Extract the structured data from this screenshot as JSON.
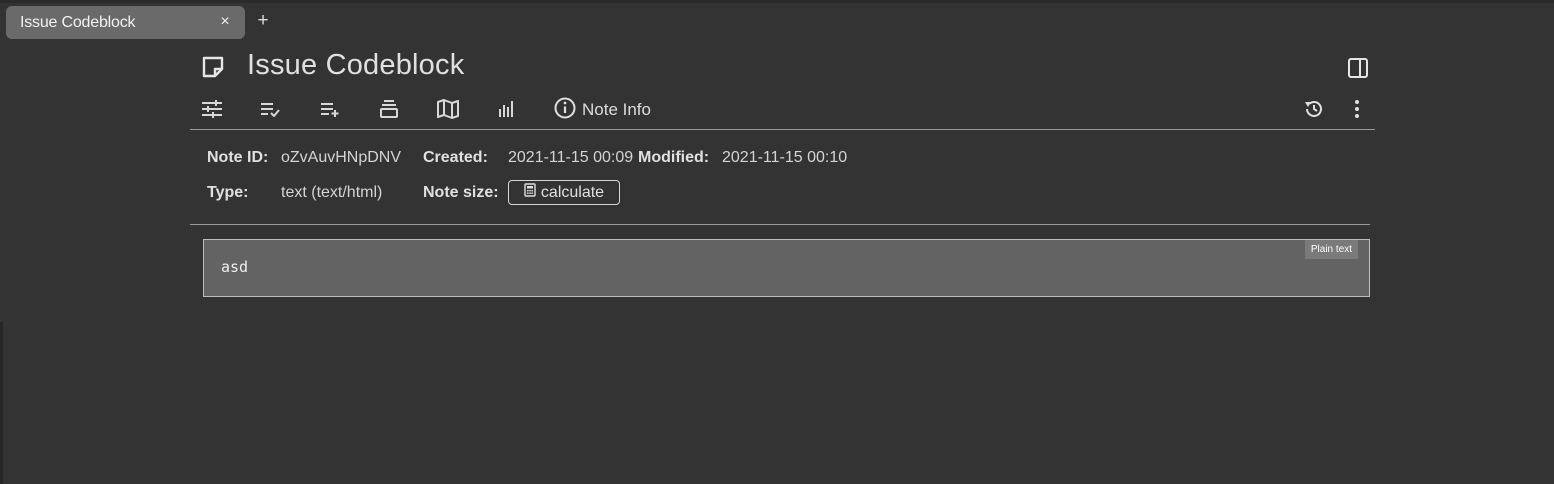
{
  "tabs": [
    {
      "title": "Issue Codeblock",
      "close_glyph": "×"
    }
  ],
  "new_tab_glyph": "+",
  "note": {
    "title": "Issue Codeblock",
    "icon": "note-icon"
  },
  "ribbon": {
    "icons": [
      "sliders-icon",
      "list-check-icon",
      "list-add-icon",
      "stack-icon",
      "map-icon",
      "bar-chart-icon"
    ],
    "active_tab": {
      "icon": "info-icon",
      "label": "Note Info"
    },
    "right_icons": [
      "history-icon",
      "more-vertical-icon"
    ]
  },
  "note_info": {
    "note_id_label": "Note ID:",
    "note_id": "oZvAuvHNpDNV",
    "created_label": "Created:",
    "created": "2021-11-15 00:09",
    "modified_label": "Modified:",
    "modified": "2021-11-15 00:10",
    "type_label": "Type:",
    "type": "text (text/html)",
    "size_label": "Note size:",
    "calculate_label": "calculate"
  },
  "code_block": {
    "content": "asd",
    "language": "Plain text"
  },
  "colors": {
    "background": "#333333",
    "tab_active": "#6a6a6a",
    "code_bg": "#636363",
    "text": "#d8d8d8"
  }
}
